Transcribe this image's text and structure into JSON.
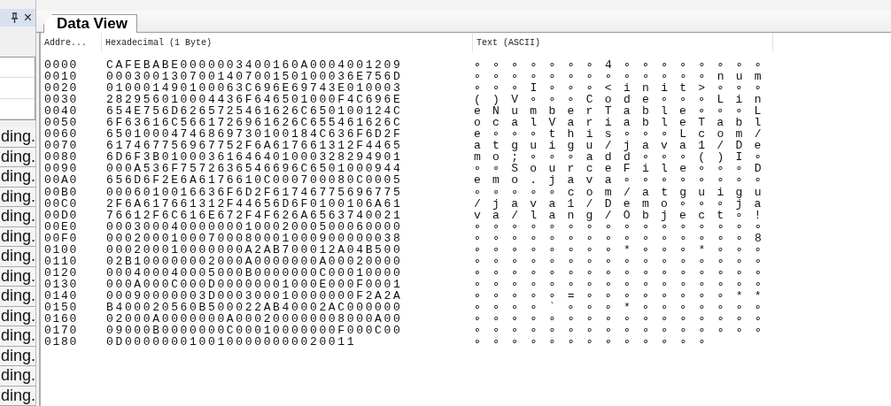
{
  "side_panel": {
    "close": "×",
    "rows": [
      "ding.",
      "ding.",
      "ding.",
      "ding.",
      "ding.",
      "ding.",
      "ding.",
      "ding.",
      "ding.",
      "ding.",
      "ding.",
      "ding.",
      "ding.",
      "ding."
    ]
  },
  "tabs": [
    {
      "label": "Data View",
      "selected": true
    }
  ],
  "table": {
    "columns": [
      "Addre...",
      "Hexadecimal (1 Byte)",
      "Text (ASCII)"
    ],
    "rows": [
      {
        "address": "0000",
        "hex": "CAFEBABE0000003400160A0004001209",
        "text": "∘∘∘∘∘∘∘4∘∘∘∘∘∘∘∘"
      },
      {
        "address": "0010",
        "hex": "000300130700140700150100036E756D",
        "text": "∘∘∘∘∘∘∘∘∘∘∘∘∘num"
      },
      {
        "address": "0020",
        "hex": "010001490100063C696E69743E010003",
        "text": "∘∘∘I∘∘∘<init>∘∘∘"
      },
      {
        "address": "0030",
        "hex": "282956010004436F646501000F4C696E",
        "text": "()V∘∘∘Code∘∘∘Lin"
      },
      {
        "address": "0040",
        "hex": "654E756D6265725461626C650100124C",
        "text": "eNumberTable∘∘∘L"
      },
      {
        "address": "0050",
        "hex": "6F63616C5661726961626C655461626C",
        "text": "ocalVariableTabl"
      },
      {
        "address": "0060",
        "hex": "65010004746869730100184C636F6D2F",
        "text": "e∘∘∘this∘∘∘Lcom/"
      },
      {
        "address": "0070",
        "hex": "617467756967752F6A617661312F4465",
        "text": "atguigu/java1/De"
      },
      {
        "address": "0080",
        "hex": "6D6F3B01000361646401000328294901",
        "text": "mo;∘∘∘add∘∘∘()I∘"
      },
      {
        "address": "0090",
        "hex": "000A536F7572636546696C6501000944",
        "text": "∘∘SourceFile∘∘∘D"
      },
      {
        "address": "00A0",
        "hex": "656D6F2E6A6176610C000700080C0005",
        "text": "emo.java∘∘∘∘∘∘∘∘"
      },
      {
        "address": "00B0",
        "hex": "0006010016636F6D2F61746775696775",
        "text": "∘∘∘∘∘com/atguigu"
      },
      {
        "address": "00C0",
        "hex": "2F6A617661312F44656D6F0100106A61",
        "text": "/java1/Demo∘∘∘ja"
      },
      {
        "address": "00D0",
        "hex": "76612F6C616E672F4F626A6563740021",
        "text": "va/lang/Object∘!"
      },
      {
        "address": "00E0",
        "hex": "00030004000000010002000500060000",
        "text": "∘∘∘∘∘∘∘∘∘∘∘∘∘∘∘∘"
      },
      {
        "address": "00F0",
        "hex": "00020001000700080001000900000038",
        "text": "∘∘∘∘∘∘∘∘∘∘∘∘∘∘∘8"
      },
      {
        "address": "0100",
        "hex": "000200010000000A2AB700012A04B500",
        "text": "∘∘∘∘∘∘∘∘*∘∘∘*∘∘∘"
      },
      {
        "address": "0110",
        "hex": "02B100000002000A0000000A00020000",
        "text": "∘∘∘∘∘∘∘∘∘∘∘∘∘∘∘∘"
      },
      {
        "address": "0120",
        "hex": "000400040005000B0000000C00010000",
        "text": "∘∘∘∘∘∘∘∘∘∘∘∘∘∘∘∘"
      },
      {
        "address": "0130",
        "hex": "000A000C000D00000001000E000F0001",
        "text": "∘∘∘∘∘∘∘∘∘∘∘∘∘∘∘∘"
      },
      {
        "address": "0140",
        "hex": "00090000003D000300010000000F2A2A",
        "text": "∘∘∘∘∘=∘∘∘∘∘∘∘∘**"
      },
      {
        "address": "0150",
        "hex": "B400020560B500022AB40002AC000000",
        "text": "∘∘∘∘`∘∘∘*∘∘∘∘∘∘∘"
      },
      {
        "address": "0160",
        "hex": "02000A0000000A000200000008000A00",
        "text": "∘∘∘∘∘∘∘∘∘∘∘∘∘∘∘∘"
      },
      {
        "address": "0170",
        "hex": "09000B0000000C00010000000F000C00",
        "text": "∘∘∘∘∘∘∘∘∘∘∘∘∘∘∘∘"
      },
      {
        "address": "0180",
        "hex": "0D0000000100100000000020011",
        "text": "∘∘∘∘∘∘∘∘∘∘∘∘∘"
      }
    ]
  }
}
